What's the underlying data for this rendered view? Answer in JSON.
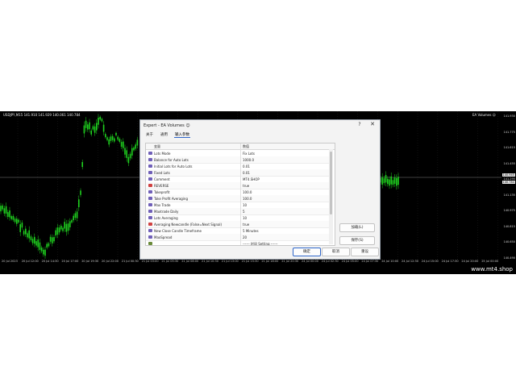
{
  "chart": {
    "symbol_label": "USDJPY,M15  141.910 141.929 140.061 140.784",
    "ea_label": "EA Volumes ☺",
    "colors": {
      "background": "#000000",
      "candle": "#1fd21f",
      "grid": "#2a2a2a",
      "level": "#808080"
    },
    "price_ticks": [
      "141.930",
      "141.775",
      "141.615",
      "141.455",
      "141.295",
      "141.135",
      "140.975",
      "140.815",
      "140.650",
      "140.490"
    ],
    "price_tags": [
      "140.945",
      "140.784"
    ],
    "time_ticks": [
      "20 Jul 2023",
      "20 Jul 12:00",
      "20 Jul 14:30",
      "20 Jul 17:00",
      "20 Jul 19:30",
      "20 Jul 22:00",
      "21 Jul 00:30",
      "21 Jul 03:00",
      "21 Jul 05:30",
      "21 Jul 08:00",
      "21 Jul 10:30",
      "21 Jul 13:00",
      "21 Jul 15:30",
      "21 Jul 18:00",
      "21 Jul 20:30",
      "24 Jul 00:00",
      "24 Jul 02:30",
      "24 Jul 05:00",
      "24 Jul 07:30",
      "24 Jul 10:00",
      "24 Jul 12:30",
      "24 Jul 15:00",
      "24 Jul 17:30",
      "24 Jul 20:00",
      "25 Jul 00:00"
    ],
    "watermark": "www.mt4.shop"
  },
  "dialog": {
    "title": "Expert - EA Volumes ☺",
    "help": "?",
    "close": "✕",
    "tabs": [
      "关于",
      "通用",
      "输入参数"
    ],
    "active_tab": 2,
    "columns": {
      "name": "变量",
      "value": "数值"
    },
    "rows": [
      {
        "name": "Lots Mode",
        "value": "Fix Lots",
        "icon": "param"
      },
      {
        "name": "Balance for Auto Lots",
        "value": "1000.0",
        "icon": "param"
      },
      {
        "name": "Initial Lots for Auto Lots",
        "value": "0.01",
        "icon": "param"
      },
      {
        "name": "Fixed Lots",
        "value": "0.01",
        "icon": "param"
      },
      {
        "name": "Comment",
        "value": "MT4.SHOP",
        "icon": "param"
      },
      {
        "name": "REVERSE",
        "value": "true",
        "icon": "flag"
      },
      {
        "name": "Takeprofit",
        "value": "100.0",
        "icon": "param"
      },
      {
        "name": "Take Profit Averaging",
        "value": "100.0",
        "icon": "param"
      },
      {
        "name": "Max Trade",
        "value": "10",
        "icon": "param"
      },
      {
        "name": "Maxtrade Daily",
        "value": "5",
        "icon": "param"
      },
      {
        "name": "Lots Averaging",
        "value": "10",
        "icon": "param"
      },
      {
        "name": "Averaging Newcandle (False=Next Signal)",
        "value": "true",
        "icon": "flag"
      },
      {
        "name": "New Close Candle Timeframe",
        "value": "5 Minutes",
        "icon": "param"
      },
      {
        "name": "MaxSpread",
        "value": "20",
        "icon": "param"
      },
      {
        "name": "",
        "value": "------ 时间 Setting ------",
        "icon": "sep"
      }
    ],
    "side_buttons": {
      "load": "加载(L)",
      "save": "保存(S)"
    },
    "buttons": {
      "ok": "确定",
      "cancel": "取消",
      "reset": "重设"
    }
  }
}
